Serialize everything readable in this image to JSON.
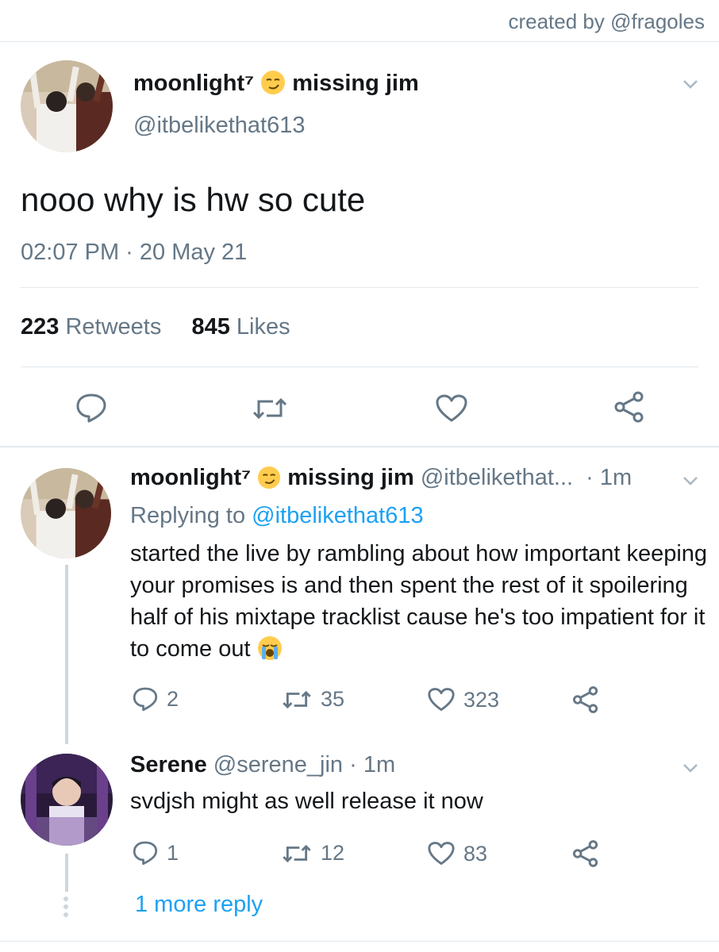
{
  "credit": "created by @fragoles",
  "main_tweet": {
    "name": "moonlight⁷",
    "name_suffix": "missing jim",
    "handle": "@itbelikethat613",
    "text": "nooo why is hw so cute",
    "timestamp": "02:07 PM · 20 May 21",
    "retweets": "223",
    "retweets_label": "Retweets",
    "likes": "845",
    "likes_label": "Likes",
    "name_emoji": "smirk-face-icon"
  },
  "replies": [
    {
      "name": "moonlight⁷",
      "name_suffix": "missing jim",
      "handle": "@itbelikethat...",
      "time": "· 1m",
      "replying_prefix": "Replying to",
      "replying_to": "@itbelikethat613",
      "text": "started the live by rambling about how important keeping your promises is and then spent the rest of it spoilering half of his mixtape tracklist cause he's too impatient for it to come out",
      "replies": "2",
      "retweets": "35",
      "likes": "323",
      "text_emoji": "loudly-crying-face-icon"
    },
    {
      "name": "Serene",
      "handle": "@serene_jin",
      "time": "· 1m",
      "text": "svdjsh might as well release it now",
      "replies": "1",
      "retweets": "12",
      "likes": "83"
    }
  ],
  "more_reply": "1 more reply",
  "colors": {
    "text": "#14171a",
    "secondary": "#657786",
    "link": "#1da1f2",
    "divider": "#e1e8ed",
    "thread": "#ccd6dd"
  }
}
